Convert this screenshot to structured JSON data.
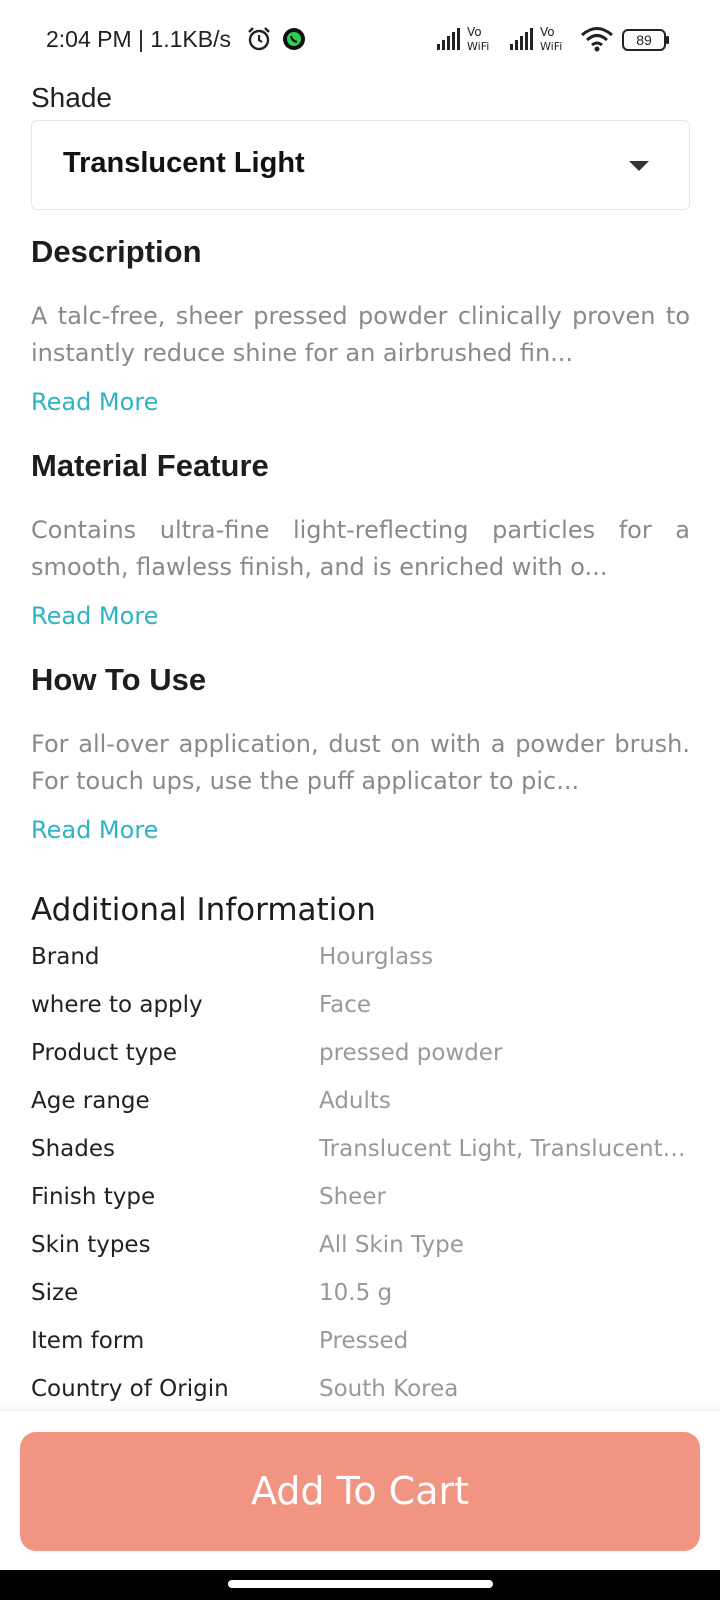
{
  "status_bar": {
    "time": "2:04 PM | 1.1KB/s",
    "battery": "89",
    "icons": [
      "alarm-icon",
      "call-icon",
      "signal-icon",
      "vowifi-icon",
      "wifi-icon",
      "battery-icon"
    ]
  },
  "shade": {
    "label": "Shade",
    "selected": "Translucent Light"
  },
  "sections": [
    {
      "title": "Description",
      "body": "A talc-free, sheer pressed powder clinically proven to instantly reduce shine for an airbrushed fin...",
      "read_more": "Read More"
    },
    {
      "title": "Material Feature",
      "body": "Contains ultra-fine light-reflecting particles for a smooth, flawless finish, and is enriched with o...",
      "read_more": "Read More"
    },
    {
      "title": "How To Use",
      "body": "For all-over application, dust on with a powder brush. For touch ups, use the puff applicator to pic...",
      "read_more": "Read More"
    }
  ],
  "additional_info": {
    "title": "Additional Information",
    "rows": [
      {
        "key": "Brand",
        "value": "Hourglass"
      },
      {
        "key": "where to apply",
        "value": "Face"
      },
      {
        "key": "Product type",
        "value": "pressed powder"
      },
      {
        "key": "Age range",
        "value": "Adults"
      },
      {
        "key": "Shades",
        "value": "Translucent Light, Translucent ..."
      },
      {
        "key": "Finish type",
        "value": "Sheer"
      },
      {
        "key": "Skin types",
        "value": "All Skin Type"
      },
      {
        "key": "Size",
        "value": "10.5 g"
      },
      {
        "key": "Item form",
        "value": "Pressed"
      },
      {
        "key": "Country of Origin",
        "value": "South Korea"
      }
    ]
  },
  "cart": {
    "label": "Add To Cart",
    "color": "#f29482"
  },
  "colors": {
    "link": "#2fb3c4",
    "muted_text": "#8a8a8a"
  }
}
